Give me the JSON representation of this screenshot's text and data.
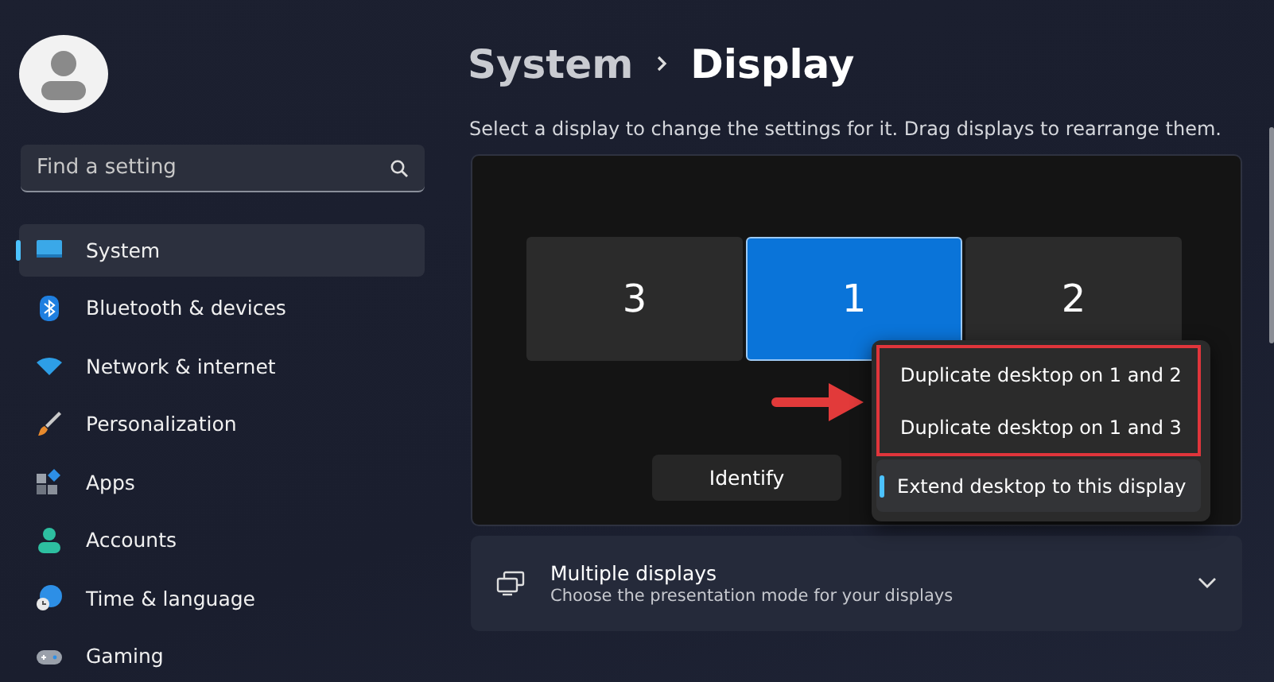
{
  "sidebar": {
    "search": {
      "placeholder": "Find a setting"
    },
    "items": [
      {
        "label": "System",
        "selected": true
      },
      {
        "label": "Bluetooth & devices",
        "selected": false
      },
      {
        "label": "Network & internet",
        "selected": false
      },
      {
        "label": "Personalization",
        "selected": false
      },
      {
        "label": "Apps",
        "selected": false
      },
      {
        "label": "Accounts",
        "selected": false
      },
      {
        "label": "Time & language",
        "selected": false
      },
      {
        "label": "Gaming",
        "selected": false
      }
    ]
  },
  "breadcrumb": [
    "System",
    "Display"
  ],
  "description": "Select a display to change the settings for it. Drag displays to rearrange them.",
  "displays": [
    {
      "label": "3",
      "selected": false
    },
    {
      "label": "1",
      "selected": true
    },
    {
      "label": "2",
      "selected": false
    }
  ],
  "identify_button": "Identify",
  "menu": {
    "items": [
      {
        "label": "Duplicate desktop on 1 and 2",
        "selected": false,
        "annotated": true
      },
      {
        "label": "Duplicate desktop on 1 and 3",
        "selected": false,
        "annotated": true
      },
      {
        "label": "Extend desktop to this display",
        "selected": true,
        "annotated": false
      }
    ]
  },
  "multiple_displays": {
    "title": "Multiple displays",
    "subtitle": "Choose the presentation mode for your displays",
    "expanded": false
  }
}
